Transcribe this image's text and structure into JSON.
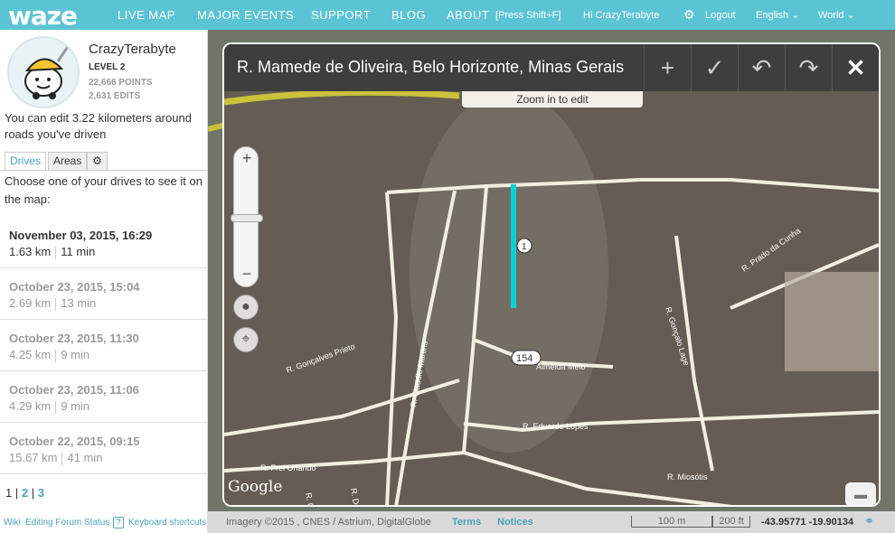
{
  "brand": {
    "logo": "waze",
    "accent": "#5bc4d4"
  },
  "nav": {
    "items": [
      "LIVE MAP",
      "MAJOR EVENTS",
      "SUPPORT",
      "BLOG",
      "ABOUT"
    ],
    "shortcut_hint": "[Press Shift+F]",
    "greeting": "Hi CrazyTerabyte",
    "logout": "Logout",
    "language": "English",
    "region": "World"
  },
  "user": {
    "name": "CrazyTerabyte",
    "level": "LEVEL 2",
    "points": "22,666 POINTS",
    "edits": "2,631 EDITS",
    "edit_note": "You can edit 3.22 kilometers around roads you've driven"
  },
  "tabs": [
    "Drives",
    "Areas"
  ],
  "drives_prompt": "Choose one of your drives to see it on the map:",
  "drives": [
    {
      "date": "November 03, 2015, 16:29",
      "distance": "1.63 km",
      "duration": "11 min"
    },
    {
      "date": "October 23, 2015, 15:04",
      "distance": "2.69 km",
      "duration": "13 min"
    },
    {
      "date": "October 23, 2015, 11:30",
      "distance": "4.25 km",
      "duration": "9 min"
    },
    {
      "date": "October 23, 2015, 11:06",
      "distance": "4.29 km",
      "duration": "9 min"
    },
    {
      "date": "October 22, 2015, 09:15",
      "distance": "15.67 km",
      "duration": "41 min"
    }
  ],
  "pager": {
    "current": "1",
    "pages": [
      "2",
      "3"
    ]
  },
  "footer": [
    "Wiki",
    "Editing Forum",
    "Status",
    "?",
    "Keyboard shortcuts"
  ],
  "editor": {
    "title": "R. Mamede de Oliveira, Belo Horizonte, Minas Gerais",
    "zoom_hint": "Zoom in to edit",
    "house_numbers": [
      "1",
      "154"
    ],
    "streets": [
      "R. Claudio Martins",
      "R. Gonçalves Prieto",
      "R. Frei Orlando",
      "R. Eduardo Lopes",
      "R. Gonçalo Lage",
      "R. Prado da Cunha",
      "R. Miosótis",
      "R. De...",
      "R. Catu...",
      "Almeida Melo"
    ],
    "google": "Google"
  },
  "map_footer": {
    "imagery": "Imagery ©2015 , CNES / Astrium, DigitalGlobe",
    "terms": "Terms",
    "notices": "Notices",
    "scale_m": "100 m",
    "scale_ft": "200 ft",
    "coords": "-43.95771 -19.90134"
  }
}
